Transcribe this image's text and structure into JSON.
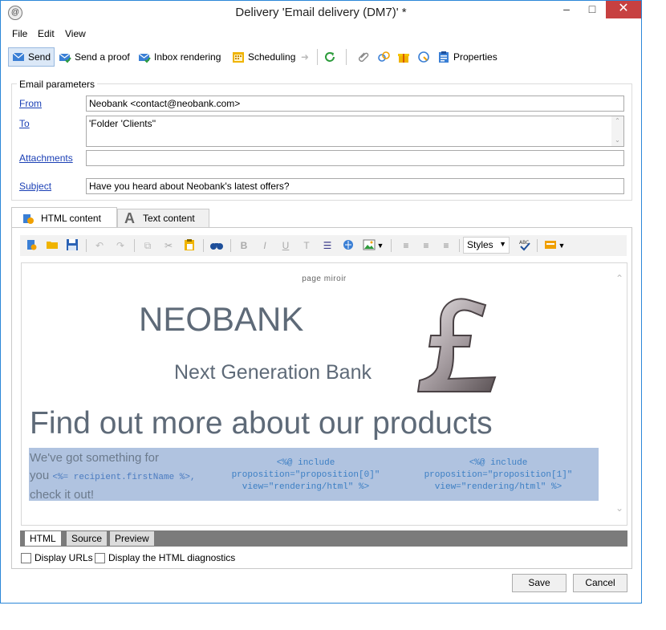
{
  "window": {
    "title": "Delivery 'Email delivery (DM7)' *",
    "minimize_glyph": "▭",
    "maximize_glyph": "□",
    "close_glyph": "✕"
  },
  "menu": [
    "File",
    "Edit",
    "View"
  ],
  "toolbar": {
    "send": "Send",
    "send_proof": "Send a proof",
    "inbox_rendering": "Inbox rendering",
    "scheduling": "Scheduling",
    "properties": "Properties"
  },
  "email_params": {
    "group_title": "Email parameters",
    "from_label": "From",
    "from_value": "Neobank <contact@neobank.com>",
    "to_label": "To",
    "to_value": "'Folder 'Clients''",
    "attachments_label": "Attachments",
    "attachments_value": "",
    "subject_label": "Subject",
    "subject_value": "Have you heard about Neobank's latest offers?"
  },
  "content_tabs": [
    "HTML content",
    "Text content"
  ],
  "editor": {
    "styles_label": "Styles",
    "mirror": "page miroir",
    "brand": "NEOBANK",
    "tagline": "Next Generation Bank",
    "headline": "Find out more about our products",
    "intro_line1": "We've got something for",
    "intro_line2_prefix": "you",
    "intro_code": "<%= recipient.firstName %>,",
    "intro_line3": "check it out!",
    "prop0_l1": "<%@ include",
    "prop0_l2": "proposition=\"proposition[0]\"",
    "prop0_l3": "view=\"rendering/html\" %>",
    "prop1_l1": "<%@ include",
    "prop1_l2": "proposition=\"proposition[1]\"",
    "prop1_l3": "view=\"rendering/html\" %>"
  },
  "view_tabs": [
    "HTML",
    "Source",
    "Preview"
  ],
  "options": {
    "display_urls": "Display URLs",
    "display_diagnostics": "Display the HTML diagnostics"
  },
  "buttons": {
    "save": "Save",
    "cancel": "Cancel"
  },
  "icons": {
    "send": "envelope-arrow-icon",
    "scheduling": "calendar-icon",
    "refresh": "refresh-icon",
    "attach": "paperclip-icon",
    "properties": "clipboard-icon"
  },
  "colors": {
    "accent": "#2b87d8",
    "close_red": "#c74040",
    "selection": "#b0c3e0",
    "link": "#1a3fb5",
    "text_gray": "#5e6a78"
  }
}
